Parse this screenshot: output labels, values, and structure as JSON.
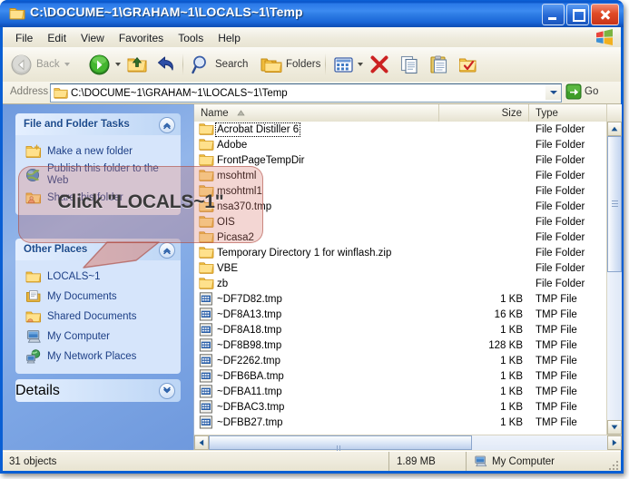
{
  "window": {
    "title": "C:\\DOCUME~1\\GRAHAM~1\\LOCALS~1\\Temp",
    "title_icon": "folder-icon",
    "minimize_label": "Minimize",
    "maximize_label": "Maximize",
    "close_label": "Close",
    "accent_color": "#0a5fd4"
  },
  "menubar": {
    "items": [
      {
        "label": "File"
      },
      {
        "label": "Edit"
      },
      {
        "label": "View"
      },
      {
        "label": "Favorites"
      },
      {
        "label": "Tools"
      },
      {
        "label": "Help"
      }
    ],
    "brand_icon": "windows-flag-icon"
  },
  "toolbar": {
    "back_label": "Back",
    "back_icon": "back-arrow-icon",
    "forward_icon": "forward-arrow-icon",
    "up_icon": "up-folder-icon",
    "undo_icon": "undo-icon",
    "search_label": "Search",
    "search_icon": "magnifier-icon",
    "folders_label": "Folders",
    "folders_icon": "folders-icon",
    "views_icon": "views-icon",
    "delete_icon": "delete-x-icon",
    "copy_icon": "copy-icon",
    "paste_icon": "paste-icon",
    "moveto_icon": "folder-check-icon"
  },
  "address": {
    "label": "Address",
    "value": "C:\\DOCUME~1\\GRAHAM~1\\LOCALS~1\\Temp",
    "placeholder": "",
    "folder_icon": "folder-icon",
    "dropdown_icon": "chevron-down-icon",
    "go_label": "Go",
    "go_icon": "go-arrow-icon"
  },
  "sidebar": {
    "tasks_panel": {
      "title": "File and Folder Tasks",
      "collapse_icon": "chevron-up-icon",
      "items": [
        {
          "label": "Make a new folder",
          "icon": "new-folder-icon"
        },
        {
          "label": "Publish this folder to the Web",
          "icon": "publish-web-icon"
        },
        {
          "label": "Share this folder",
          "icon": "share-folder-icon"
        }
      ]
    },
    "other_places_panel": {
      "title": "Other Places",
      "collapse_icon": "chevron-up-icon",
      "items": [
        {
          "label": "LOCALS~1",
          "icon": "folder-icon"
        },
        {
          "label": "My Documents",
          "icon": "my-documents-icon"
        },
        {
          "label": "Shared Documents",
          "icon": "shared-documents-icon"
        },
        {
          "label": "My Computer",
          "icon": "my-computer-icon"
        },
        {
          "label": "My Network Places",
          "icon": "network-places-icon"
        }
      ]
    },
    "details_panel": {
      "title": "Details",
      "expand_icon": "chevron-down-icon"
    }
  },
  "filelist": {
    "columns": [
      {
        "label": "Name",
        "sorted": "asc",
        "sort_icon": "sort-ascending-icon"
      },
      {
        "label": "Size"
      },
      {
        "label": "Type"
      }
    ],
    "rows": [
      {
        "name": "Acrobat Distiller 6",
        "size": "",
        "type": "File Folder",
        "icon": "folder-icon",
        "focused": true
      },
      {
        "name": "Adobe",
        "size": "",
        "type": "File Folder",
        "icon": "folder-icon"
      },
      {
        "name": "FrontPageTempDir",
        "size": "",
        "type": "File Folder",
        "icon": "folder-icon"
      },
      {
        "name": "msohtml",
        "size": "",
        "type": "File Folder",
        "icon": "folder-icon"
      },
      {
        "name": "msohtml1",
        "size": "",
        "type": "File Folder",
        "icon": "folder-icon"
      },
      {
        "name": "nsa370.tmp",
        "size": "",
        "type": "File Folder",
        "icon": "folder-icon"
      },
      {
        "name": "OIS",
        "size": "",
        "type": "File Folder",
        "icon": "folder-icon"
      },
      {
        "name": "Picasa2",
        "size": "",
        "type": "File Folder",
        "icon": "folder-icon"
      },
      {
        "name": "Temporary Directory 1 for winflash.zip",
        "size": "",
        "type": "File Folder",
        "icon": "folder-icon"
      },
      {
        "name": "VBE",
        "size": "",
        "type": "File Folder",
        "icon": "folder-icon"
      },
      {
        "name": "zb",
        "size": "",
        "type": "File Folder",
        "icon": "folder-icon"
      },
      {
        "name": "~DF7D82.tmp",
        "size": "1 KB",
        "type": "TMP File",
        "icon": "tmp-file-icon"
      },
      {
        "name": "~DF8A13.tmp",
        "size": "16 KB",
        "type": "TMP File",
        "icon": "tmp-file-icon"
      },
      {
        "name": "~DF8A18.tmp",
        "size": "1 KB",
        "type": "TMP File",
        "icon": "tmp-file-icon"
      },
      {
        "name": "~DF8B98.tmp",
        "size": "128 KB",
        "type": "TMP File",
        "icon": "tmp-file-icon"
      },
      {
        "name": "~DF2262.tmp",
        "size": "1 KB",
        "type": "TMP File",
        "icon": "tmp-file-icon"
      },
      {
        "name": "~DFB6BA.tmp",
        "size": "1 KB",
        "type": "TMP File",
        "icon": "tmp-file-icon"
      },
      {
        "name": "~DFBA11.tmp",
        "size": "1 KB",
        "type": "TMP File",
        "icon": "tmp-file-icon"
      },
      {
        "name": "~DFBAC3.tmp",
        "size": "1 KB",
        "type": "TMP File",
        "icon": "tmp-file-icon"
      },
      {
        "name": "~DFBB27.tmp",
        "size": "1 KB",
        "type": "TMP File",
        "icon": "tmp-file-icon"
      }
    ]
  },
  "statusbar": {
    "object_count": "31 objects",
    "total_size": "1.89 MB",
    "location": "My Computer",
    "location_icon": "my-computer-icon"
  },
  "callout": {
    "text": "Click \"LOCALS~1\"",
    "fill_color": "#d7786e",
    "border_color": "#aa463c"
  }
}
